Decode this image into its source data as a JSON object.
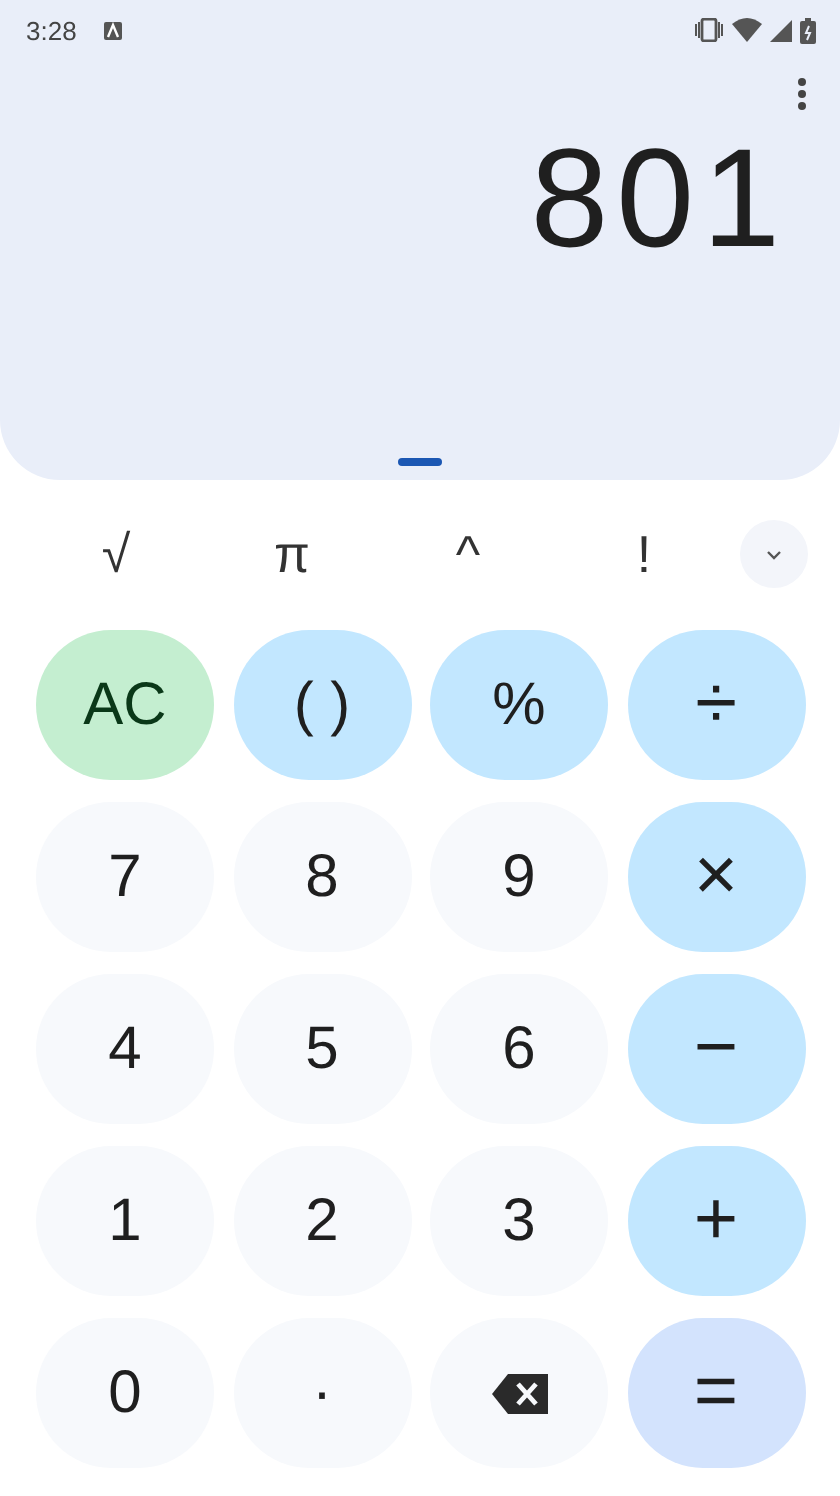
{
  "status_bar": {
    "time": "3:28"
  },
  "display": {
    "value": "801"
  },
  "scientific_keys": [
    {
      "label": "√"
    },
    {
      "label": "π"
    },
    {
      "label": "^"
    },
    {
      "label": "!"
    }
  ],
  "keys": [
    {
      "kind": "clear",
      "label": "AC"
    },
    {
      "kind": "function",
      "label": "( )"
    },
    {
      "kind": "function",
      "label": "%"
    },
    {
      "kind": "operator",
      "label": "÷"
    },
    {
      "kind": "digit",
      "label": "7"
    },
    {
      "kind": "digit",
      "label": "8"
    },
    {
      "kind": "digit",
      "label": "9"
    },
    {
      "kind": "operator",
      "label": "×"
    },
    {
      "kind": "digit",
      "label": "4"
    },
    {
      "kind": "digit",
      "label": "5"
    },
    {
      "kind": "digit",
      "label": "6"
    },
    {
      "kind": "operator",
      "label": "−"
    },
    {
      "kind": "digit",
      "label": "1"
    },
    {
      "kind": "digit",
      "label": "2"
    },
    {
      "kind": "digit",
      "label": "3"
    },
    {
      "kind": "operator",
      "label": "+"
    },
    {
      "kind": "digit",
      "label": "0"
    },
    {
      "kind": "digit",
      "label": "·"
    },
    {
      "kind": "backspace"
    },
    {
      "kind": "equals",
      "label": "="
    }
  ]
}
